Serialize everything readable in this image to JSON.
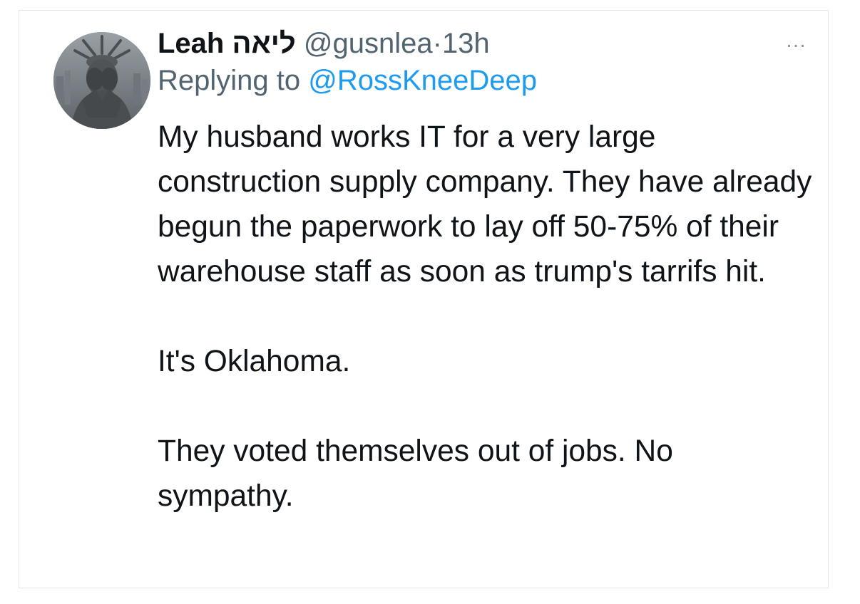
{
  "tweet": {
    "display_name": "Leah ליאה",
    "handle": "@gusnlea",
    "separator": "·",
    "time": "13h",
    "replying_prefix": "Replying to",
    "replying_handle": "@RossKneeDeep",
    "more_icon": "…",
    "paragraphs": [
      "My husband works IT for a very large construction supply company. They have already begun the paperwork to lay off 50-75% of their warehouse staff as soon as trump's tarrifs hit.",
      "It's Oklahoma.",
      "They voted themselves out of jobs. No sympathy."
    ]
  },
  "colors": {
    "text_primary": "#0f1419",
    "text_secondary": "#536471",
    "link": "#1d9bf0",
    "border": "#e3e6ea"
  }
}
